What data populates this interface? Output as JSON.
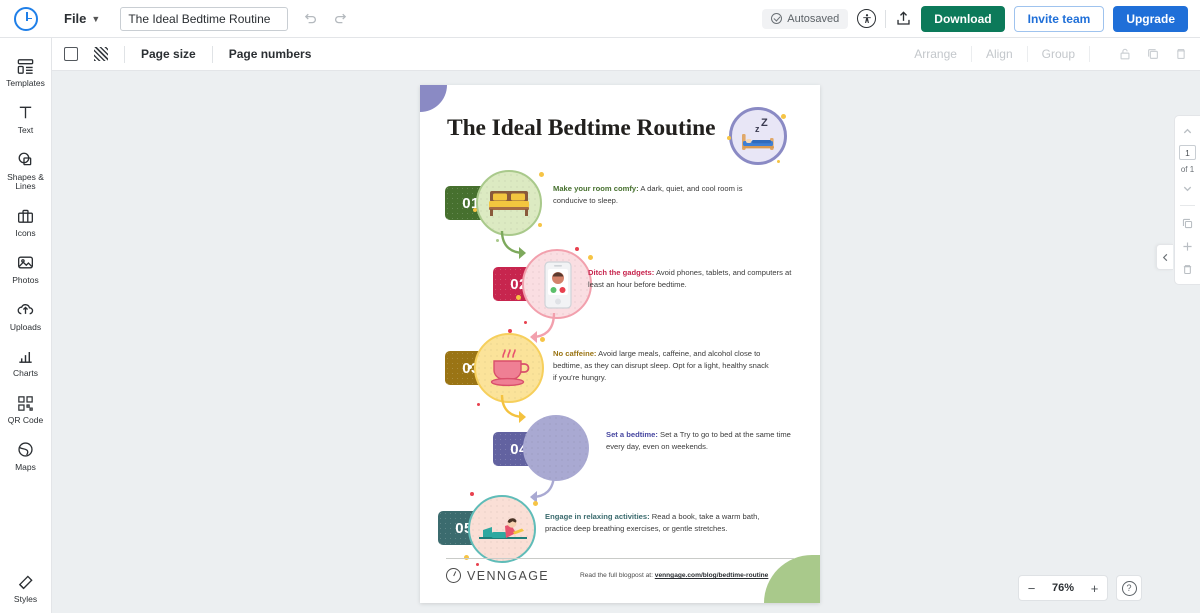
{
  "app": {
    "logo": "venngage-clock-logo",
    "file_menu": "File",
    "document_title": "The Ideal Bedtime Routine",
    "autosaved": "Autosaved",
    "download": "Download",
    "invite": "Invite team",
    "upgrade": "Upgrade"
  },
  "toolbar": {
    "page_size": "Page size",
    "page_numbers": "Page numbers",
    "arrange": "Arrange",
    "align": "Align",
    "group": "Group"
  },
  "sidebar": {
    "items": [
      {
        "label": "Templates",
        "icon": "templates-icon"
      },
      {
        "label": "Text",
        "icon": "text-icon"
      },
      {
        "label": "Shapes & Lines",
        "icon": "shapes-lines-icon"
      },
      {
        "label": "Icons",
        "icon": "icons-icon"
      },
      {
        "label": "Photos",
        "icon": "photos-icon"
      },
      {
        "label": "Uploads",
        "icon": "uploads-icon"
      },
      {
        "label": "Charts",
        "icon": "charts-icon"
      },
      {
        "label": "QR Code",
        "icon": "qr-code-icon"
      },
      {
        "label": "Maps",
        "icon": "maps-icon"
      }
    ],
    "bottom": {
      "label": "Styles",
      "icon": "styles-brush-icon"
    }
  },
  "pages_panel": {
    "current_page": "1",
    "total_label": "of 1"
  },
  "zoom": {
    "minus": "−",
    "value": "76%",
    "plus": "+",
    "help": "?"
  },
  "infographic": {
    "title": "The Ideal Bedtime Routine",
    "header_icon": "sleeping-in-bed-icon",
    "steps": [
      {
        "number": "01",
        "badge_color": "#46702e",
        "circle_fill": "#dceac2",
        "circle_border": "#a9c98b",
        "icon": "bed-icon",
        "heading": "Make your room comfy:",
        "heading_color": "#46702e",
        "body": " A dark, quiet, and cool room is conducive to sleep."
      },
      {
        "number": "02",
        "badge_color": "#c7254e",
        "circle_fill": "#fadee2",
        "circle_border": "#f2a0ad",
        "icon": "smartphone-video-call-icon",
        "heading": "Ditch the gadgets:",
        "heading_color": "#c7254e",
        "body": " Avoid phones, tablets, and computers at least an hour before bedtime."
      },
      {
        "number": "03",
        "badge_color": "#9a7414",
        "circle_fill": "#fbe39a",
        "circle_border": "#f6cf5c",
        "icon": "coffee-cup-icon",
        "heading": "No caffeine:",
        "heading_color": "#9a7414",
        "body": "  Avoid large meals, caffeine, and alcohol close to bedtime, as they can disrupt sleep. Opt for a light, healthy snack if you're hungry."
      },
      {
        "number": "04",
        "badge_color": "#6262a0",
        "circle_fill": "#a9a9d2",
        "circle_border": "#a9a9d2",
        "icon": "alarm-clock-icon",
        "heading": "Set a bedtime:",
        "heading_color": "#4646a0",
        "body": " Set a Try to go to bed at the same time every day, even on weekends."
      },
      {
        "number": "05",
        "badge_color": "#3b6b6e",
        "circle_fill": "#fadfd6",
        "circle_border": "#5fbcb8",
        "icon": "person-reading-icon",
        "heading": "Engage in relaxing activities:",
        "heading_color": "#3b6b6e",
        "body": " Read a book, take a warm bath, practice deep breathing exercises, or gentle stretches."
      }
    ],
    "footer": {
      "brand": "VENNGAGE",
      "note_prefix": "Read the full blogpost at: ",
      "link": "venngage.com/blog/bedtime-routine"
    }
  }
}
